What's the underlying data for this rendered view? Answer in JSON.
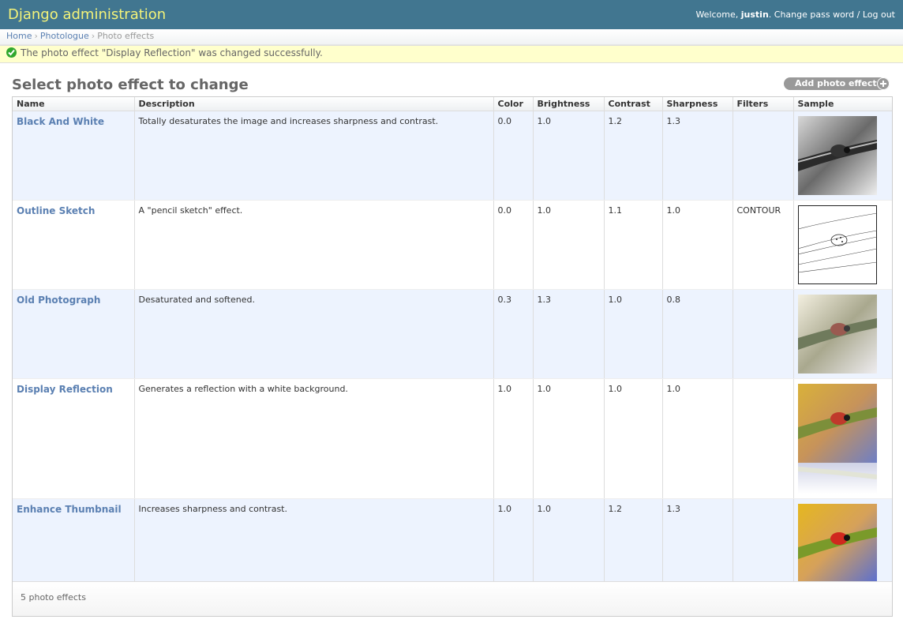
{
  "header": {
    "brand": "Django administration",
    "welcome": "Welcome, ",
    "username": "justin",
    "change_password": "Change pass word",
    "separator": " / ",
    "logout": "Log out"
  },
  "breadcrumbs": {
    "home": "Home",
    "app": "Photologue",
    "current": "Photo effects",
    "sep": "›"
  },
  "message": {
    "text": "The photo effect \"Display Reflection\" was changed successfully."
  },
  "page": {
    "title": "Select photo effect to change",
    "add_button": "Add photo effect"
  },
  "table": {
    "columns": [
      "Name",
      "Description",
      "Color",
      "Brightness",
      "Contrast",
      "Sharpness",
      "Filters",
      "Sample"
    ],
    "rows": [
      {
        "name": "Black And White",
        "description": "Totally desaturates the image and increases sharpness and contrast.",
        "color": "0.0",
        "brightness": "1.0",
        "contrast": "1.2",
        "sharpness": "1.3",
        "filters": "",
        "sample": "grayscale"
      },
      {
        "name": "Outline Sketch",
        "description": "A \"pencil sketch\" effect.",
        "color": "0.0",
        "brightness": "1.0",
        "contrast": "1.1",
        "sharpness": "1.0",
        "filters": "CONTOUR",
        "sample": "sketch"
      },
      {
        "name": "Old Photograph",
        "description": "Desaturated and softened.",
        "color": "0.3",
        "brightness": "1.3",
        "contrast": "1.0",
        "sharpness": "0.8",
        "filters": "",
        "sample": "faded"
      },
      {
        "name": "Display Reflection",
        "description": "Generates a reflection with a white background.",
        "color": "1.0",
        "brightness": "1.0",
        "contrast": "1.0",
        "sharpness": "1.0",
        "filters": "",
        "sample": "reflection"
      },
      {
        "name": "Enhance Thumbnail",
        "description": "Increases sharpness and contrast.",
        "color": "1.0",
        "brightness": "1.0",
        "contrast": "1.2",
        "sharpness": "1.3",
        "filters": "",
        "sample": "color"
      }
    ]
  },
  "paginator": {
    "count_text": "5 photo effects"
  },
  "colors": {
    "header_bg": "#417690",
    "brand": "#f4f379",
    "link": "#5b80b2",
    "message_bg": "#ffffcc",
    "row_alt": "#edf3fe",
    "success": "#32a82e"
  }
}
